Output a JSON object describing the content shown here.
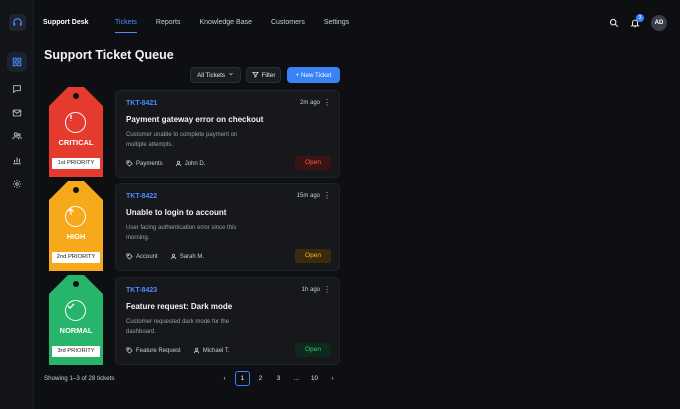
{
  "app": {
    "brand": "Support Desk"
  },
  "nav": {
    "tabs": [
      "Tickets",
      "Reports",
      "Knowledge Base",
      "Customers",
      "Settings"
    ],
    "active_index": 0
  },
  "header": {
    "notifications_count": "3",
    "avatar_initials": "AD"
  },
  "page": {
    "title": "Support Ticket Queue"
  },
  "toolbar": {
    "dropdown_value": "All Tickets",
    "filter_label": "Filter",
    "new_label": "+ New Ticket"
  },
  "tickets": [
    {
      "level": "CRITICAL",
      "priority": "1st PRIORITY",
      "tag_color": "#e53a2e",
      "icon": "exclamation-icon",
      "id": "TKT-8421",
      "time": "2m ago",
      "title": "Payment gateway error on checkout",
      "desc": "Customer unable to complete payment on multiple attempts.",
      "category": "Payments",
      "assignee": "John D.",
      "status": "Open",
      "status_color": "#ff5a4d"
    },
    {
      "level": "HIGH",
      "priority": "2nd PRIORITY",
      "tag_color": "#f5a91b",
      "icon": "arrow-up-icon",
      "id": "TKT-8422",
      "time": "15m ago",
      "title": "Unable to login to account",
      "desc": "User facing authentication error since this morning.",
      "category": "Account",
      "assignee": "Sarah M.",
      "status": "Open",
      "status_color": "#f5b534"
    },
    {
      "level": "NORMAL",
      "priority": "3rd PRIORITY",
      "tag_color": "#27b56b",
      "icon": "check-icon",
      "id": "TKT-8423",
      "time": "1h ago",
      "title": "Feature request: Dark mode",
      "desc": "Customer requested dark mode for the dashboard.",
      "category": "Feature Request",
      "assignee": "Michael T.",
      "status": "Open",
      "status_color": "#33c77a"
    }
  ],
  "footer": {
    "showing": "Showing 1–3 of 28 tickets"
  },
  "pagination": {
    "prev": "‹",
    "pages": [
      "1",
      "2",
      "3",
      "…",
      "10"
    ],
    "next": "›",
    "current": "1"
  },
  "colors": {
    "accent": "#3b82f6",
    "background": "#0d0f12",
    "card": "#16181c"
  }
}
